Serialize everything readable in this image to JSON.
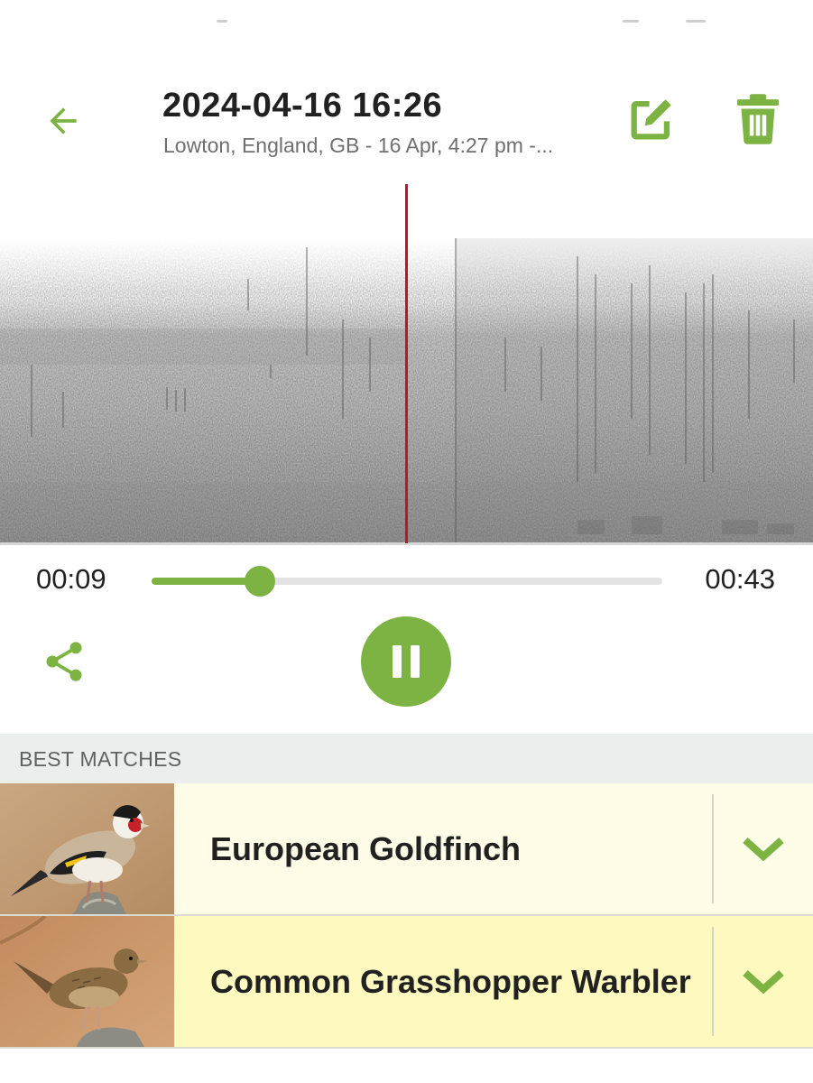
{
  "header": {
    "title": "2024-04-16 16:26",
    "subtitle": "Lowton, England, GB - 16 Apr, 4:27 pm -..."
  },
  "icons": {
    "back": "arrow-back-icon",
    "edit": "edit-icon",
    "delete": "trash-icon",
    "share": "share-icon",
    "pause": "pause-icon",
    "expand": "chevron-down-icon"
  },
  "colors": {
    "accent": "#7cb342",
    "playhead": "#c8102e",
    "row_1_bg": "#fffde8",
    "row_2_bg": "#fef9bf"
  },
  "player": {
    "current_time": "00:09",
    "total_time": "00:43",
    "progress": 0.212
  },
  "matches": {
    "header": "BEST MATCHES",
    "items": [
      {
        "name": "European Goldfinch"
      },
      {
        "name": "Common Grasshopper Warbler"
      }
    ]
  }
}
